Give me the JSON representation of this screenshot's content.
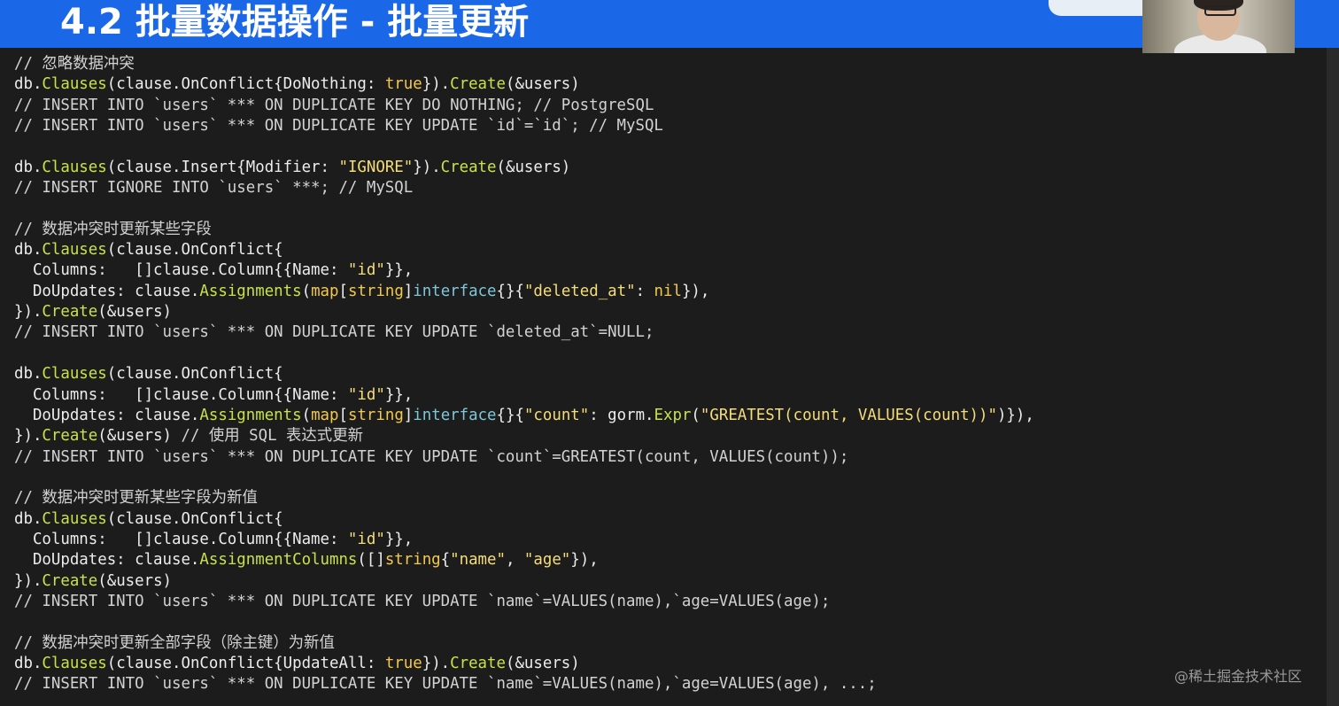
{
  "slide_title": "4.2 批量数据操作 - 批量更新",
  "watermark": "@稀土掘金技术社区",
  "colors": {
    "title_bar": "#1a67e8",
    "background": "#1c1c1c",
    "plain": "#ececec",
    "comment": "#d2d2d2",
    "function": "#c7e24a",
    "keyword": "#f2c94c",
    "string": "#f5dd78",
    "type": "#7ec7d8"
  },
  "code_lines": [
    [
      [
        "cm",
        "// 忽略数据冲突"
      ]
    ],
    [
      [
        "p",
        "db."
      ],
      [
        "fn",
        "Clauses"
      ],
      [
        "p",
        "(clause.OnConflict{DoNothing: "
      ],
      [
        "kw",
        "true"
      ],
      [
        "p",
        "})."
      ],
      [
        "fn",
        "Create"
      ],
      [
        "p",
        "(&users)"
      ]
    ],
    [
      [
        "cm",
        "// INSERT INTO `users` *** ON DUPLICATE KEY DO NOTHING; // PostgreSQL"
      ]
    ],
    [
      [
        "cm",
        "// INSERT INTO `users` *** ON DUPLICATE KEY UPDATE `id`=`id`; // MySQL"
      ]
    ],
    [],
    [
      [
        "p",
        "db."
      ],
      [
        "fn",
        "Clauses"
      ],
      [
        "p",
        "(clause.Insert{Modifier: "
      ],
      [
        "st",
        "\"IGNORE\""
      ],
      [
        "p",
        "})."
      ],
      [
        "fn",
        "Create"
      ],
      [
        "p",
        "(&users)"
      ]
    ],
    [
      [
        "cm",
        "// INSERT IGNORE INTO `users` ***; // MySQL"
      ]
    ],
    [],
    [
      [
        "cm",
        "// 数据冲突时更新某些字段"
      ]
    ],
    [
      [
        "p",
        "db."
      ],
      [
        "fn",
        "Clauses"
      ],
      [
        "p",
        "(clause.OnConflict{"
      ]
    ],
    [
      [
        "p",
        "  Columns:   []clause.Column{{Name: "
      ],
      [
        "st",
        "\"id\""
      ],
      [
        "p",
        "}},"
      ]
    ],
    [
      [
        "p",
        "  DoUpdates: clause."
      ],
      [
        "fn",
        "Assignments"
      ],
      [
        "p",
        "("
      ],
      [
        "kw",
        "map"
      ],
      [
        "p",
        "["
      ],
      [
        "kw",
        "string"
      ],
      [
        "p",
        "]"
      ],
      [
        "ty",
        "interface"
      ],
      [
        "p",
        "{}{"
      ],
      [
        "st",
        "\"deleted_at\""
      ],
      [
        "p",
        ": "
      ],
      [
        "kw",
        "nil"
      ],
      [
        "p",
        "}),"
      ]
    ],
    [
      [
        "p",
        "})."
      ],
      [
        "fn",
        "Create"
      ],
      [
        "p",
        "(&users)"
      ]
    ],
    [
      [
        "cm",
        "// INSERT INTO `users` *** ON DUPLICATE KEY UPDATE `deleted_at`=NULL;"
      ]
    ],
    [],
    [
      [
        "p",
        "db."
      ],
      [
        "fn",
        "Clauses"
      ],
      [
        "p",
        "(clause.OnConflict{"
      ]
    ],
    [
      [
        "p",
        "  Columns:   []clause.Column{{Name: "
      ],
      [
        "st",
        "\"id\""
      ],
      [
        "p",
        "}},"
      ]
    ],
    [
      [
        "p",
        "  DoUpdates: clause."
      ],
      [
        "fn",
        "Assignments"
      ],
      [
        "p",
        "("
      ],
      [
        "kw",
        "map"
      ],
      [
        "p",
        "["
      ],
      [
        "kw",
        "string"
      ],
      [
        "p",
        "]"
      ],
      [
        "ty",
        "interface"
      ],
      [
        "p",
        "{}{"
      ],
      [
        "st",
        "\"count\""
      ],
      [
        "p",
        ": gorm."
      ],
      [
        "fn",
        "Expr"
      ],
      [
        "p",
        "("
      ],
      [
        "st",
        "\"GREATEST(count, VALUES(count))\""
      ],
      [
        "p",
        ")}),"
      ]
    ],
    [
      [
        "p",
        "})."
      ],
      [
        "fn",
        "Create"
      ],
      [
        "p",
        "(&users) "
      ],
      [
        "cm",
        "// 使用 SQL 表达式更新"
      ]
    ],
    [
      [
        "cm",
        "// INSERT INTO `users` *** ON DUPLICATE KEY UPDATE `count`=GREATEST(count, VALUES(count));"
      ]
    ],
    [],
    [
      [
        "cm",
        "// 数据冲突时更新某些字段为新值"
      ]
    ],
    [
      [
        "p",
        "db."
      ],
      [
        "fn",
        "Clauses"
      ],
      [
        "p",
        "(clause.OnConflict{"
      ]
    ],
    [
      [
        "p",
        "  Columns:   []clause.Column{{Name: "
      ],
      [
        "st",
        "\"id\""
      ],
      [
        "p",
        "}},"
      ]
    ],
    [
      [
        "p",
        "  DoUpdates: clause."
      ],
      [
        "fn",
        "AssignmentColumns"
      ],
      [
        "p",
        "([]"
      ],
      [
        "kw",
        "string"
      ],
      [
        "p",
        "{"
      ],
      [
        "st",
        "\"name\""
      ],
      [
        "p",
        ", "
      ],
      [
        "st",
        "\"age\""
      ],
      [
        "p",
        "}),"
      ]
    ],
    [
      [
        "p",
        "})."
      ],
      [
        "fn",
        "Create"
      ],
      [
        "p",
        "(&users)"
      ]
    ],
    [
      [
        "cm",
        "// INSERT INTO `users` *** ON DUPLICATE KEY UPDATE `name`=VALUES(name),`age=VALUES(age);"
      ]
    ],
    [],
    [
      [
        "cm",
        "// 数据冲突时更新全部字段（除主键）为新值"
      ]
    ],
    [
      [
        "p",
        "db."
      ],
      [
        "fn",
        "Clauses"
      ],
      [
        "p",
        "(clause.OnConflict{UpdateAll: "
      ],
      [
        "kw",
        "true"
      ],
      [
        "p",
        "})."
      ],
      [
        "fn",
        "Create"
      ],
      [
        "p",
        "(&users)"
      ]
    ],
    [
      [
        "cm",
        "// INSERT INTO `users` *** ON DUPLICATE KEY UPDATE `name`=VALUES(name),`age=VALUES(age), ...;"
      ]
    ]
  ]
}
